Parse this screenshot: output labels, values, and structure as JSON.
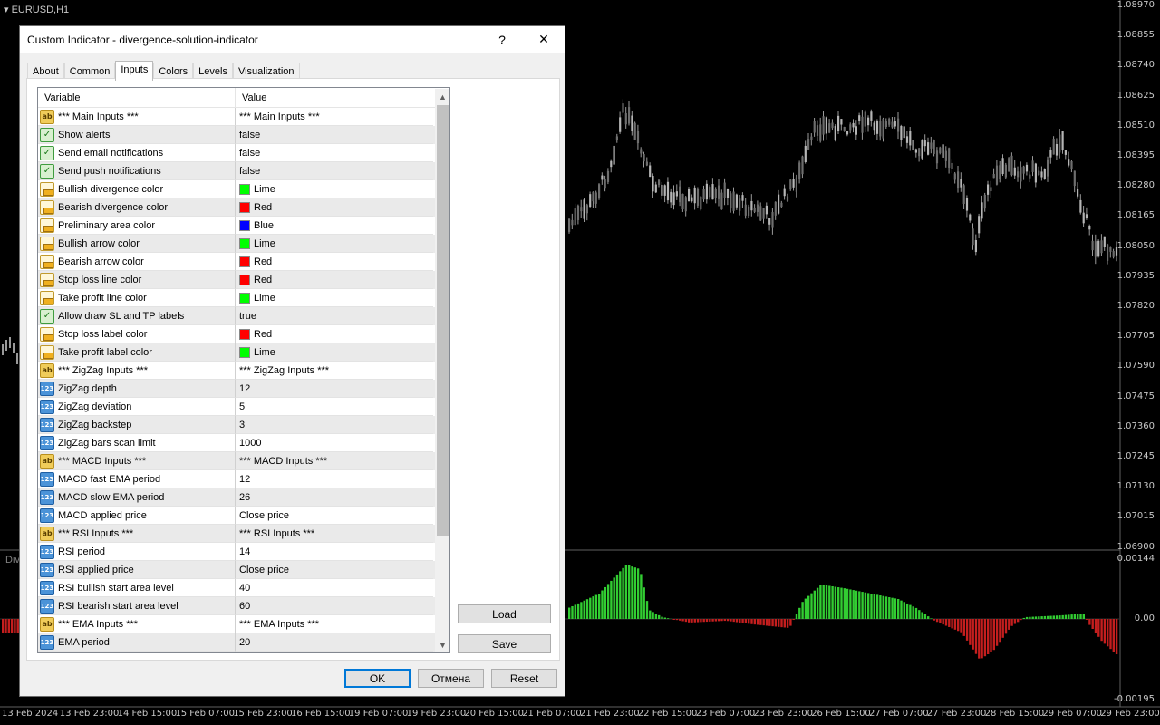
{
  "chart": {
    "symbol": "EURUSD,H1",
    "subwindow_label": "Div",
    "price_axis": [
      "1.08970",
      "1.08855",
      "1.08740",
      "1.08625",
      "1.08510",
      "1.08395",
      "1.08280",
      "1.08165",
      "1.08050",
      "1.07935",
      "1.07820",
      "1.07705",
      "1.07590",
      "1.07475",
      "1.07360",
      "1.07245",
      "1.07130",
      "1.07015",
      "1.06900"
    ],
    "indicator_axis": [
      "0.00144",
      "0.00",
      "-0.00195"
    ],
    "date_axis": [
      "13 Feb 2024",
      "13 Feb 23:00",
      "14 Feb 15:00",
      "15 Feb 07:00",
      "15 Feb 23:00",
      "16 Feb 15:00",
      "19 Feb 07:00",
      "19 Feb 23:00",
      "20 Feb 15:00",
      "21 Feb 07:00",
      "21 Feb 23:00",
      "22 Feb 15:00",
      "23 Feb 07:00",
      "23 Feb 23:00",
      "26 Feb 15:00",
      "27 Feb 07:00",
      "27 Feb 23:00",
      "28 Feb 15:00",
      "29 Feb 07:00",
      "29 Feb 23:00"
    ],
    "colors": {
      "bull": "#32cd32",
      "bear": "#d42020",
      "candle": "#a0a0a0"
    }
  },
  "dialog": {
    "title": "Custom Indicator - divergence-solution-indicator",
    "help": "?",
    "close": "✕",
    "tabs": [
      "About",
      "Common",
      "Inputs",
      "Colors",
      "Levels",
      "Visualization"
    ],
    "active_tab": "Inputs",
    "grid_headers": {
      "variable": "Variable",
      "value": "Value"
    },
    "rows": [
      {
        "type": "ab",
        "var": "*** Main Inputs ***",
        "val": "*** Main Inputs ***"
      },
      {
        "type": "bool",
        "var": "Show alerts",
        "val": "false"
      },
      {
        "type": "bool",
        "var": "Send email notifications",
        "val": "false"
      },
      {
        "type": "bool",
        "var": "Send push notifications",
        "val": "false"
      },
      {
        "type": "clr",
        "var": "Bullish divergence color",
        "val": "Lime",
        "swatch": "#00ff00"
      },
      {
        "type": "clr",
        "var": "Bearish divergence color",
        "val": "Red",
        "swatch": "#ff0000"
      },
      {
        "type": "clr",
        "var": "Preliminary area color",
        "val": "Blue",
        "swatch": "#0000ff"
      },
      {
        "type": "clr",
        "var": "Bullish arrow color",
        "val": "Lime",
        "swatch": "#00ff00"
      },
      {
        "type": "clr",
        "var": "Bearish arrow color",
        "val": "Red",
        "swatch": "#ff0000"
      },
      {
        "type": "clr",
        "var": "Stop loss line color",
        "val": "Red",
        "swatch": "#ff0000"
      },
      {
        "type": "clr",
        "var": "Take profit line color",
        "val": "Lime",
        "swatch": "#00ff00"
      },
      {
        "type": "bool",
        "var": "Allow draw SL and TP labels",
        "val": "true"
      },
      {
        "type": "clr",
        "var": "Stop loss label color",
        "val": "Red",
        "swatch": "#ff0000"
      },
      {
        "type": "clr",
        "var": "Take profit label color",
        "val": "Lime",
        "swatch": "#00ff00"
      },
      {
        "type": "ab",
        "var": "*** ZigZag Inputs ***",
        "val": "*** ZigZag Inputs ***"
      },
      {
        "type": "num",
        "var": "ZigZag depth",
        "val": "12"
      },
      {
        "type": "num",
        "var": "ZigZag deviation",
        "val": "5"
      },
      {
        "type": "num",
        "var": "ZigZag backstep",
        "val": "3"
      },
      {
        "type": "num",
        "var": "ZigZag bars scan limit",
        "val": "1000"
      },
      {
        "type": "ab",
        "var": "*** MACD Inputs ***",
        "val": "*** MACD Inputs ***"
      },
      {
        "type": "num",
        "var": "MACD fast EMA period",
        "val": "12"
      },
      {
        "type": "num",
        "var": "MACD slow EMA period",
        "val": "26"
      },
      {
        "type": "num",
        "var": "MACD applied price",
        "val": "Close price"
      },
      {
        "type": "ab",
        "var": "*** RSI Inputs ***",
        "val": "*** RSI Inputs ***"
      },
      {
        "type": "num",
        "var": "RSI period",
        "val": "14"
      },
      {
        "type": "num",
        "var": "RSI applied price",
        "val": "Close price"
      },
      {
        "type": "num",
        "var": "RSI bullish start area level",
        "val": "40"
      },
      {
        "type": "num",
        "var": "RSI bearish start area level",
        "val": "60"
      },
      {
        "type": "ab",
        "var": "*** EMA Inputs ***",
        "val": "*** EMA Inputs ***"
      },
      {
        "type": "num",
        "var": "EMA period",
        "val": "20"
      }
    ],
    "icons": {
      "ab": "ab",
      "num": "123",
      "bool": "✓"
    },
    "buttons": {
      "load": "Load",
      "save": "Save",
      "ok": "OK",
      "cancel": "Отмена",
      "reset": "Reset"
    }
  }
}
